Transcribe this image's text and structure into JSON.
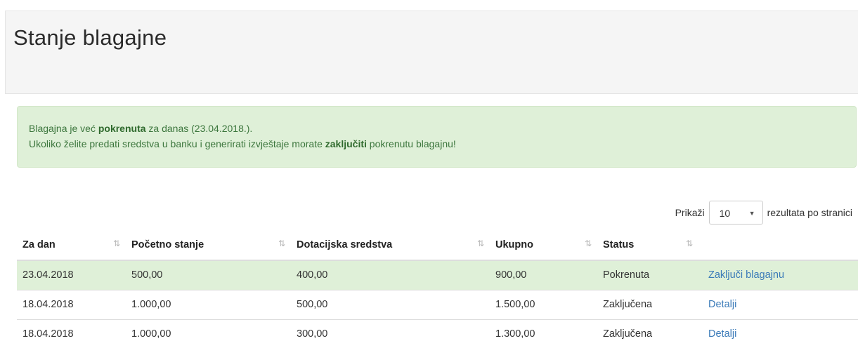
{
  "page": {
    "title": "Stanje blagajne"
  },
  "alert": {
    "line1_pre": "Blagajna je već ",
    "line1_bold": "pokrenuta",
    "line1_post": " za danas (23.04.2018.).",
    "line2_pre": "Ukoliko želite predati sredstva u banku i generirati izvještaje morate ",
    "line2_bold": "zaključiti",
    "line2_post": " pokrenutu blagajnu!"
  },
  "length": {
    "prefix": "Prikaži",
    "value": "10",
    "suffix": "rezultata po stranici"
  },
  "table": {
    "headers": [
      "Za dan",
      "Početno stanje",
      "Dotacijska sredstva",
      "Ukupno",
      "Status"
    ],
    "sort_icon": "⇅",
    "rows": [
      {
        "date": "23.04.2018",
        "start": "500,00",
        "donation": "400,00",
        "total": "900,00",
        "status": "Pokrenuta",
        "action": "Zaključi blagajnu"
      },
      {
        "date": "18.04.2018",
        "start": "1.000,00",
        "donation": "500,00",
        "total": "1.500,00",
        "status": "Zaključena",
        "action": "Detalji"
      },
      {
        "date": "18.04.2018",
        "start": "1.000,00",
        "donation": "300,00",
        "total": "1.300,00",
        "status": "Zaključena",
        "action": "Detalji"
      }
    ]
  },
  "icons": {
    "sort": "sort-arrows-icon",
    "dropdown": "chevron-down-icon"
  },
  "colors": {
    "alert_bg": "#dff0d8",
    "alert_text": "#3c763d",
    "link": "#3a7ab8",
    "header_bg": "#f5f5f5"
  }
}
